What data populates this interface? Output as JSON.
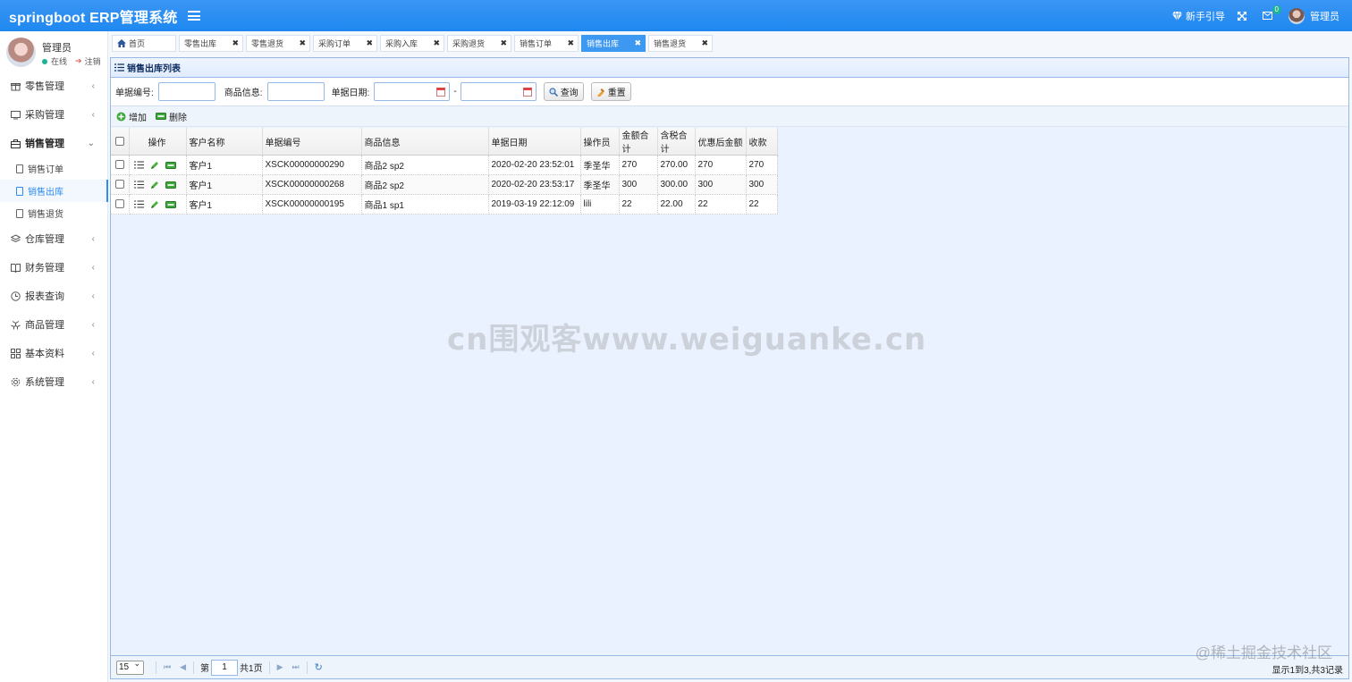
{
  "header": {
    "brand": "springboot ERP管理系统",
    "guide_label": "新手引导",
    "mail_badge": "0",
    "user_label": "管理员",
    "bg_color": "#2d8cf0"
  },
  "sidebar": {
    "user_name": "管理员",
    "status_online": "在线",
    "status_logout": "注销",
    "items": [
      {
        "label": "零售管理",
        "icon": "gift-icon"
      },
      {
        "label": "采购管理",
        "icon": "monitor-icon"
      },
      {
        "label": "销售管理",
        "icon": "shop-icon"
      },
      {
        "label": "仓库管理",
        "icon": "layers-icon"
      },
      {
        "label": "财务管理",
        "icon": "book-icon"
      },
      {
        "label": "报表查询",
        "icon": "clock-icon"
      },
      {
        "label": "商品管理",
        "icon": "cubes-icon"
      },
      {
        "label": "基本资料",
        "icon": "grid-icon"
      },
      {
        "label": "系统管理",
        "icon": "gear-icon"
      }
    ],
    "sub_items": [
      {
        "label": "销售订单"
      },
      {
        "label": "销售出库"
      },
      {
        "label": "销售退货"
      }
    ]
  },
  "tabs": [
    {
      "label": "首页"
    },
    {
      "label": "零售出库"
    },
    {
      "label": "零售退货"
    },
    {
      "label": "采购订单"
    },
    {
      "label": "采购入库"
    },
    {
      "label": "采购退货"
    },
    {
      "label": "销售订单"
    },
    {
      "label": "销售出库"
    },
    {
      "label": "销售退货"
    }
  ],
  "panel": {
    "title": "销售出库列表"
  },
  "search": {
    "bill_no_label": "单据编号:",
    "product_label": "商品信息:",
    "date_label": "单据日期:",
    "dash": "-",
    "query_button": "查询",
    "reset_button": "重置"
  },
  "toolbar": {
    "add_label": "增加",
    "delete_label": "删除"
  },
  "table": {
    "columns": [
      "操作",
      "客户名称",
      "单据编号",
      "商品信息",
      "单据日期",
      "操作员",
      "金额合计",
      "含税合计",
      "优惠后金额",
      "收款"
    ],
    "rows": [
      [
        "客户1",
        "XSCK00000000290",
        "商品2 sp2",
        "2020-02-20 23:52:01",
        "季圣华",
        "270",
        "270.00",
        "270",
        "270"
      ],
      [
        "客户1",
        "XSCK00000000268",
        "商品2 sp2",
        "2020-02-20 23:53:17",
        "季圣华",
        "300",
        "300.00",
        "300",
        "300"
      ],
      [
        "客户1",
        "XSCK00000000195",
        "商品1 sp1",
        "2019-03-19 22:12:09",
        "lili",
        "22",
        "22.00",
        "22",
        "22"
      ]
    ]
  },
  "pager": {
    "page_size": "15",
    "page_prefix": "第",
    "page_value": "1",
    "page_total": "共1页",
    "info": "显示1到3,共3记录"
  },
  "watermarks": {
    "center": "cn围观客www.weiguanke.cn",
    "corner": "@稀土掘金技术社区"
  }
}
